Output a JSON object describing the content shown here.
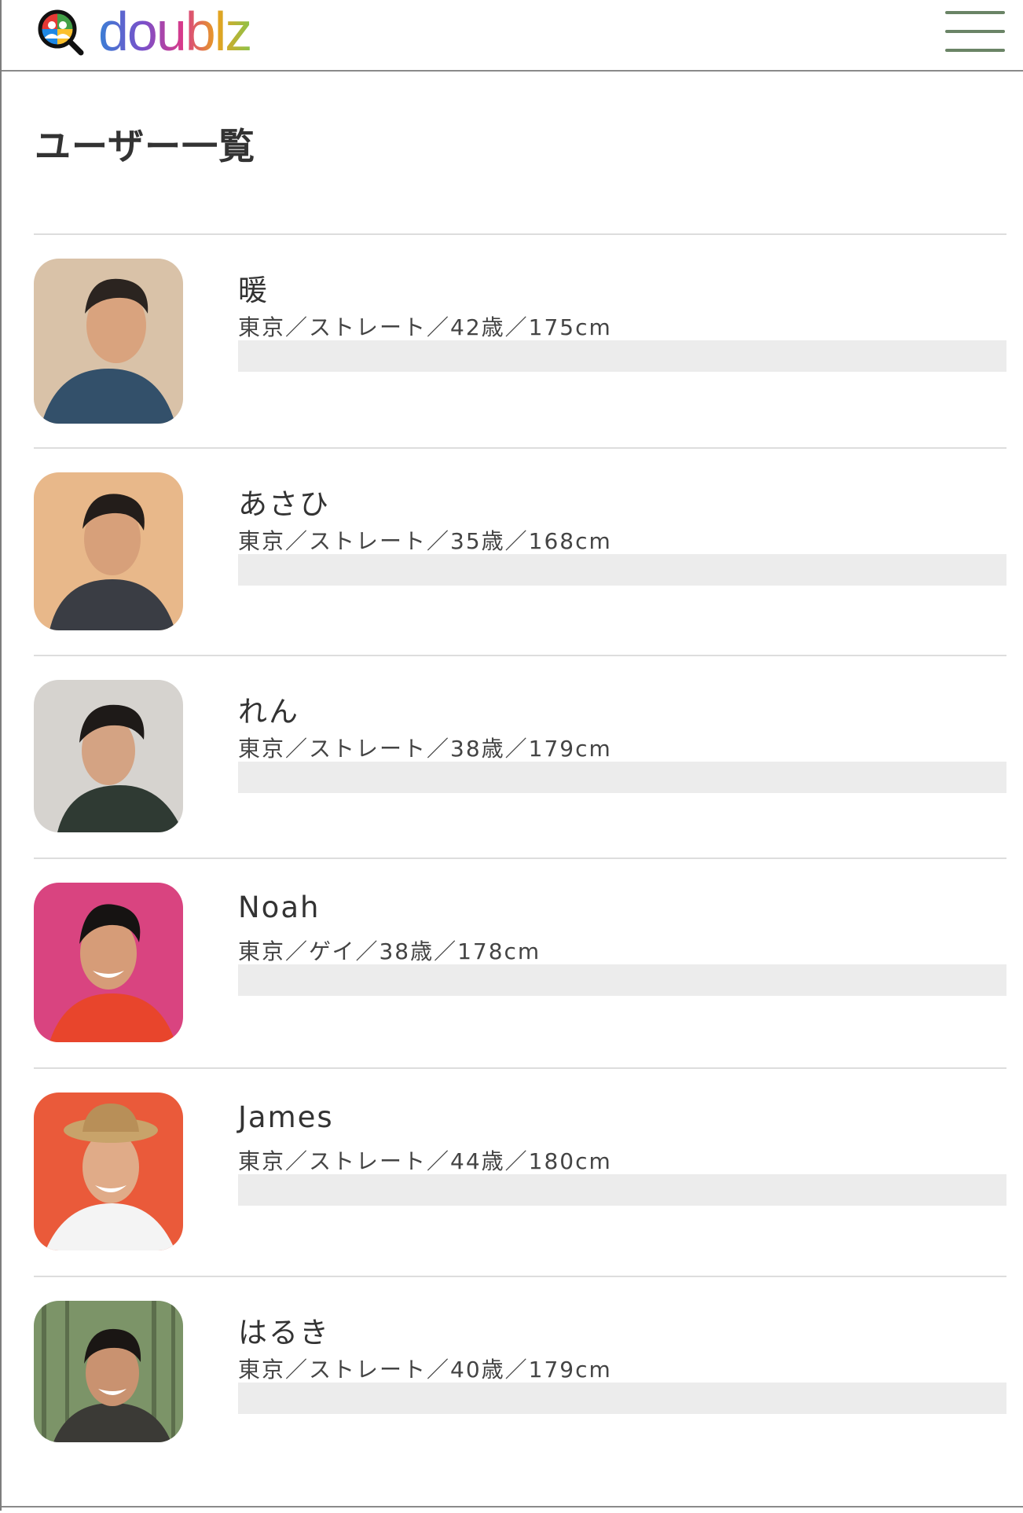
{
  "header": {
    "logo_text": "doublz",
    "logo_colors": [
      "#3a7fd5",
      "#7b4fc9",
      "#d83a8a",
      "#e8a21f",
      "#8bc34a"
    ],
    "menu_icon": "hamburger-menu-icon",
    "menu_color": "#6a8466"
  },
  "page": {
    "title": "ユーザー一覧"
  },
  "users": [
    {
      "name": "暖",
      "info": "東京／ストレート／42歳／175cm",
      "avatar_bg": "#d9c2a8",
      "shirt": "#33506a"
    },
    {
      "name": "あさひ",
      "info": "東京／ストレート／35歳／168cm",
      "avatar_bg": "#e8b88a",
      "shirt": "#3a3d44"
    },
    {
      "name": "れん",
      "info": "東京／ストレート／38歳／179cm",
      "avatar_bg": "#d6d3cf",
      "shirt": "#2f3a33"
    },
    {
      "name": "Noah",
      "info": "東京／ゲイ／38歳／178cm",
      "avatar_bg": "#d94480",
      "shirt": "#e8452c"
    },
    {
      "name": "James",
      "info": "東京／ストレート／44歳／180cm",
      "avatar_bg": "#ea5a3a",
      "shirt": "#f4f4f4"
    },
    {
      "name": "はるき",
      "info": "東京／ストレート／40歳／179cm",
      "avatar_bg": "#7c9468",
      "shirt": "#3b3a36"
    }
  ]
}
